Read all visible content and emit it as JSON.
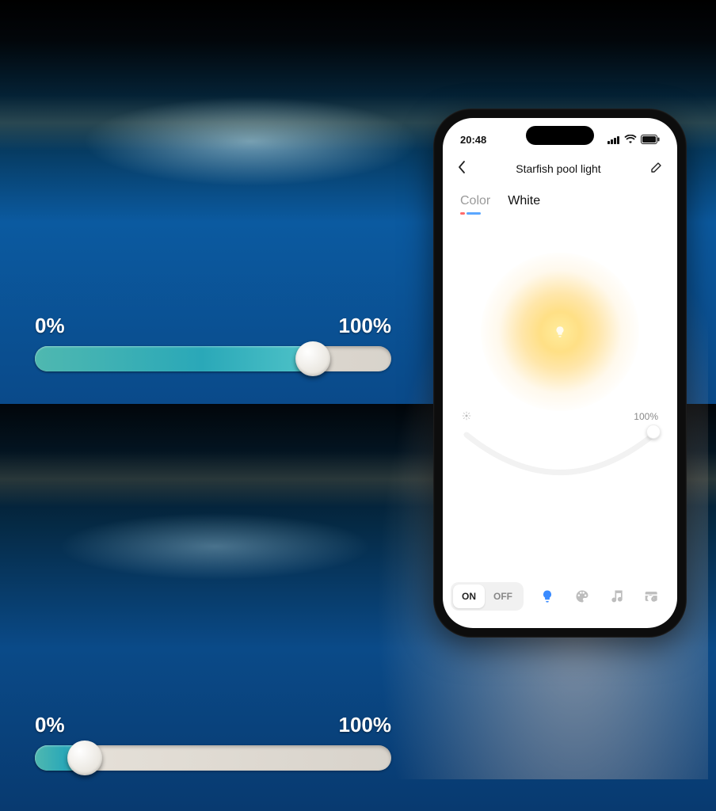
{
  "overlay_sliders": [
    {
      "min_label": "0%",
      "max_label": "100%",
      "value_percent": 78
    },
    {
      "min_label": "0%",
      "max_label": "100%",
      "value_percent": 14
    }
  ],
  "phone": {
    "status": {
      "time": "20:48"
    },
    "header": {
      "title": "Starfish pool light"
    },
    "tabs": {
      "color": "Color",
      "white": "White",
      "active": "white"
    },
    "brightness": {
      "label": "100%",
      "value_percent": 100
    },
    "power": {
      "on_label": "ON",
      "off_label": "OFF",
      "state": "on"
    },
    "bottom_nav": {
      "items": [
        "bulb",
        "palette",
        "music",
        "schedule"
      ],
      "active": "bulb"
    }
  }
}
